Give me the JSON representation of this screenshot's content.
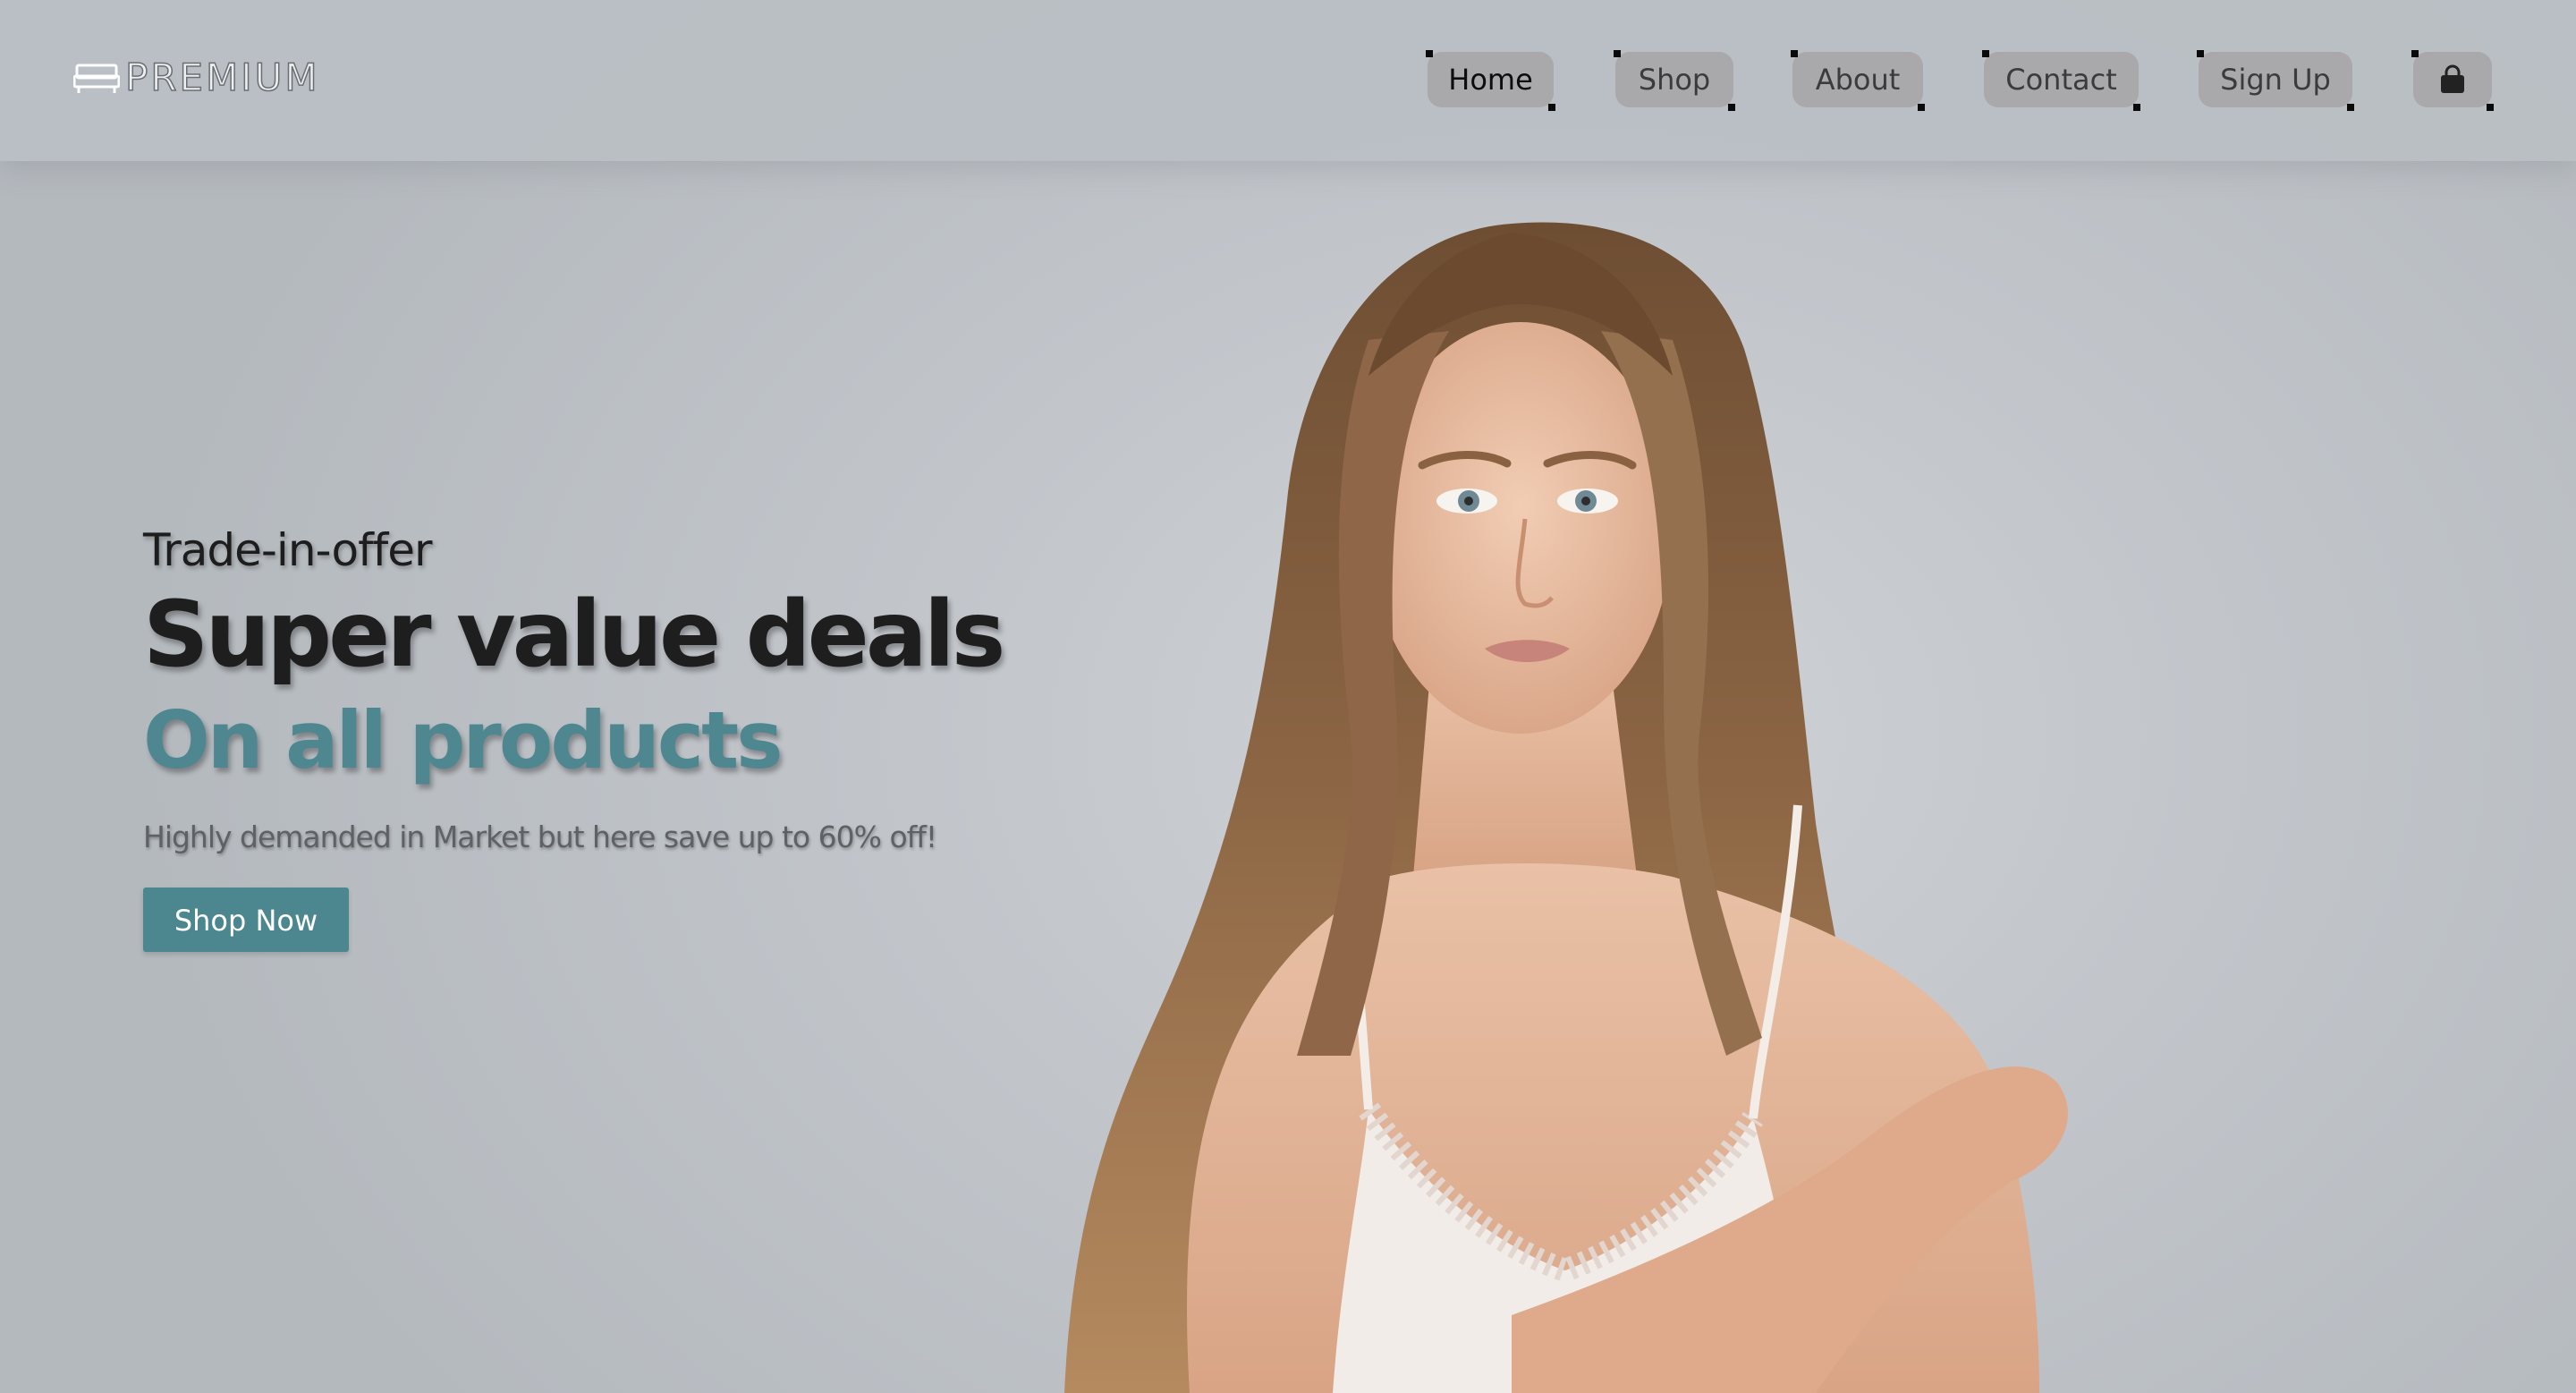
{
  "brand": {
    "logo_text": "PREMIUM",
    "logo_icon": "sofa-icon"
  },
  "nav": {
    "items": [
      {
        "label": "Home",
        "active": true
      },
      {
        "label": "Shop",
        "active": false
      },
      {
        "label": "About",
        "active": false
      },
      {
        "label": "Contact",
        "active": false
      },
      {
        "label": "Sign Up",
        "active": false
      }
    ],
    "cart_icon": "shopping-bag-icon"
  },
  "hero": {
    "eyebrow": "Trade-in-offer",
    "headline": "Super value deals",
    "subheadline": "On all products",
    "tagline": "Highly demanded in Market but here save up to 60% off!",
    "cta_label": "Shop Now",
    "image": "model-photo"
  },
  "colors": {
    "accent": "#4c8790",
    "nav_pill": "#a9a8aa",
    "background": "#c2c7cc"
  }
}
